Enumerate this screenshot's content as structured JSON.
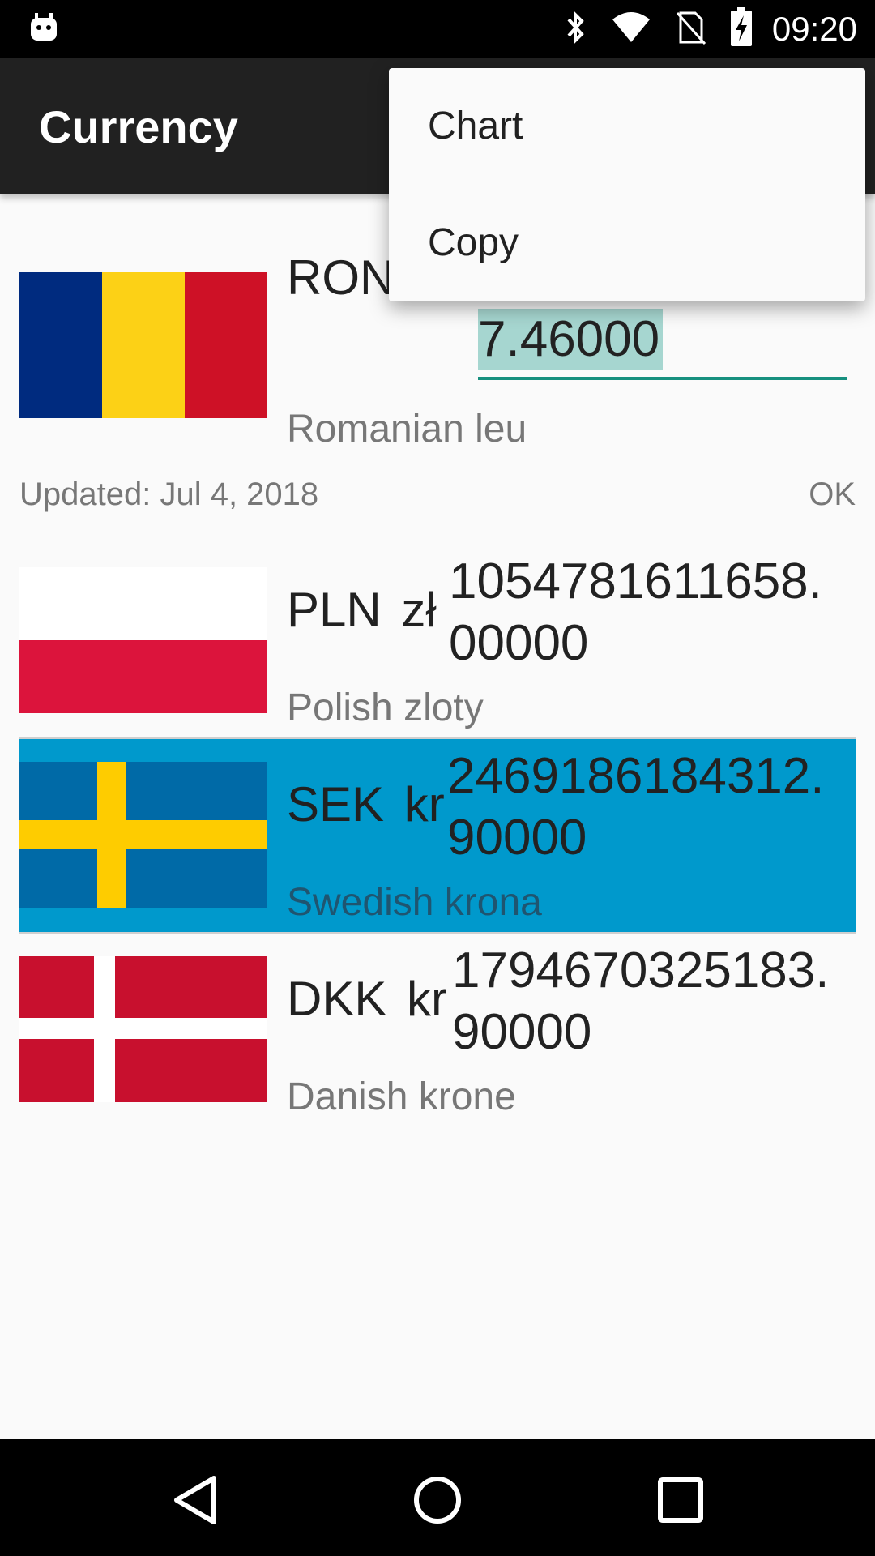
{
  "status_bar": {
    "time": "09:20",
    "icons": [
      "android-debug-icon",
      "bluetooth-icon",
      "wifi-icon",
      "no-sim-icon",
      "battery-charging-icon"
    ]
  },
  "toolbar": {
    "title": "Currency"
  },
  "menu": {
    "items": [
      "Chart",
      "Copy"
    ]
  },
  "base_currency": {
    "code": "RON",
    "name": "Romanian leu",
    "input_value": "7.46000"
  },
  "update_info": {
    "updated": "Updated: Jul 4, 2018",
    "status": "OK"
  },
  "currencies": [
    {
      "code": "PLN",
      "symbol": "zł",
      "value_line1": "1054781611658.",
      "value_line2": "00000",
      "name": "Polish zloty",
      "selected": false
    },
    {
      "code": "SEK",
      "symbol": "kr",
      "value_line1": "2469186184312.",
      "value_line2": "90000",
      "name": "Swedish krona",
      "selected": true
    },
    {
      "code": "DKK",
      "symbol": "kr",
      "value_line1": "1794670325183.",
      "value_line2": "90000",
      "name": "Danish krone",
      "selected": false
    }
  ],
  "colors": {
    "toolbar": "#212121",
    "accent": "#17907f",
    "selection": "#0099cc"
  },
  "navigation": {
    "buttons": [
      "back-icon",
      "home-icon",
      "recents-icon"
    ]
  }
}
